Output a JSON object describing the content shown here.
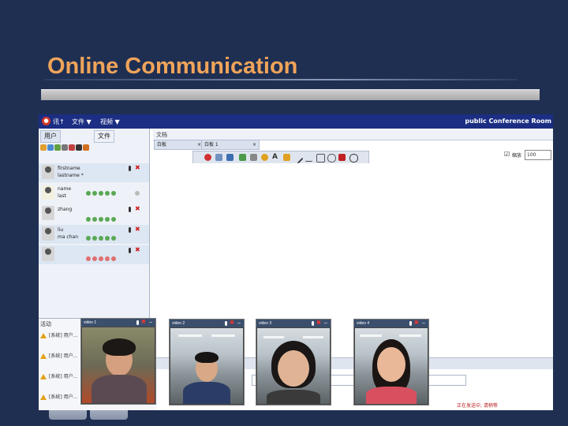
{
  "slide": {
    "title": "Online Communication"
  },
  "app": {
    "menu": [
      "讯↑",
      "文件 ▼",
      "视频 ▼"
    ],
    "room_title": "public Conference Room",
    "tabs": {
      "users": "用户",
      "files": "文件"
    },
    "doc_header": "文档",
    "doc_tabs": [
      "白板",
      "白板 1"
    ],
    "zoom": {
      "label": "缩放",
      "value": "100"
    },
    "activity_label": "活动",
    "activity_rows": [
      "[系统] 用户...",
      "[系统] 用户...",
      "[系统] 用户...",
      "[系统] 用户..."
    ],
    "footer_text": "正在发送中, 请稍等"
  },
  "users": [
    {
      "name": "firstname",
      "sub": "lastname *"
    },
    {
      "name": "name",
      "sub": "last"
    },
    {
      "name": "zhang",
      "sub": ""
    },
    {
      "name": "liu",
      "sub": "ma chan"
    },
    {
      "name": "",
      "sub": ""
    }
  ],
  "videos": [
    {
      "name": "video 1"
    },
    {
      "name": "video 2"
    },
    {
      "name": "video 3"
    },
    {
      "name": "video 4"
    }
  ],
  "colors": {
    "slide_bg": "#1f2f52",
    "title": "#f0a45a",
    "app_titlebar": "#1b2e83"
  }
}
